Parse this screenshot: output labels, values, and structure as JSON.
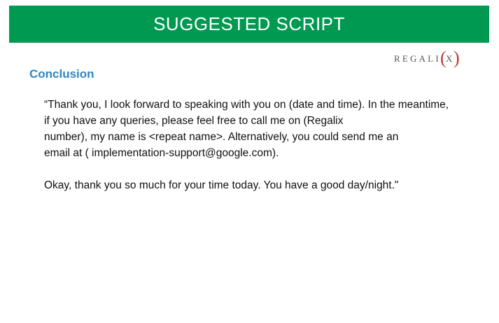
{
  "header": {
    "title": "SUGGESTED SCRIPT",
    "background_color": "#009951",
    "text_color": "#ffffff"
  },
  "logo": {
    "text": "REGALI(X)",
    "letters": "REGALI",
    "paren_left": "(",
    "x": "X",
    "paren_right": ")",
    "text_color": "#555555",
    "accent_color": "#c0392b"
  },
  "section": {
    "title": "Conclusion",
    "title_color": "#2E86C1"
  },
  "script": {
    "lines": [
      "“Thank you, I look forward to speaking with you on (date and time). In the meantime,",
      "if you have any queries, please feel free to call me on (Regalix",
      "number), my name is <repeat name>. Alternatively, you could send me an",
      "email at ( implementation-support@google.com)."
    ],
    "closing": "Okay, thank you so much for your time today. You have a good day/night.\""
  }
}
